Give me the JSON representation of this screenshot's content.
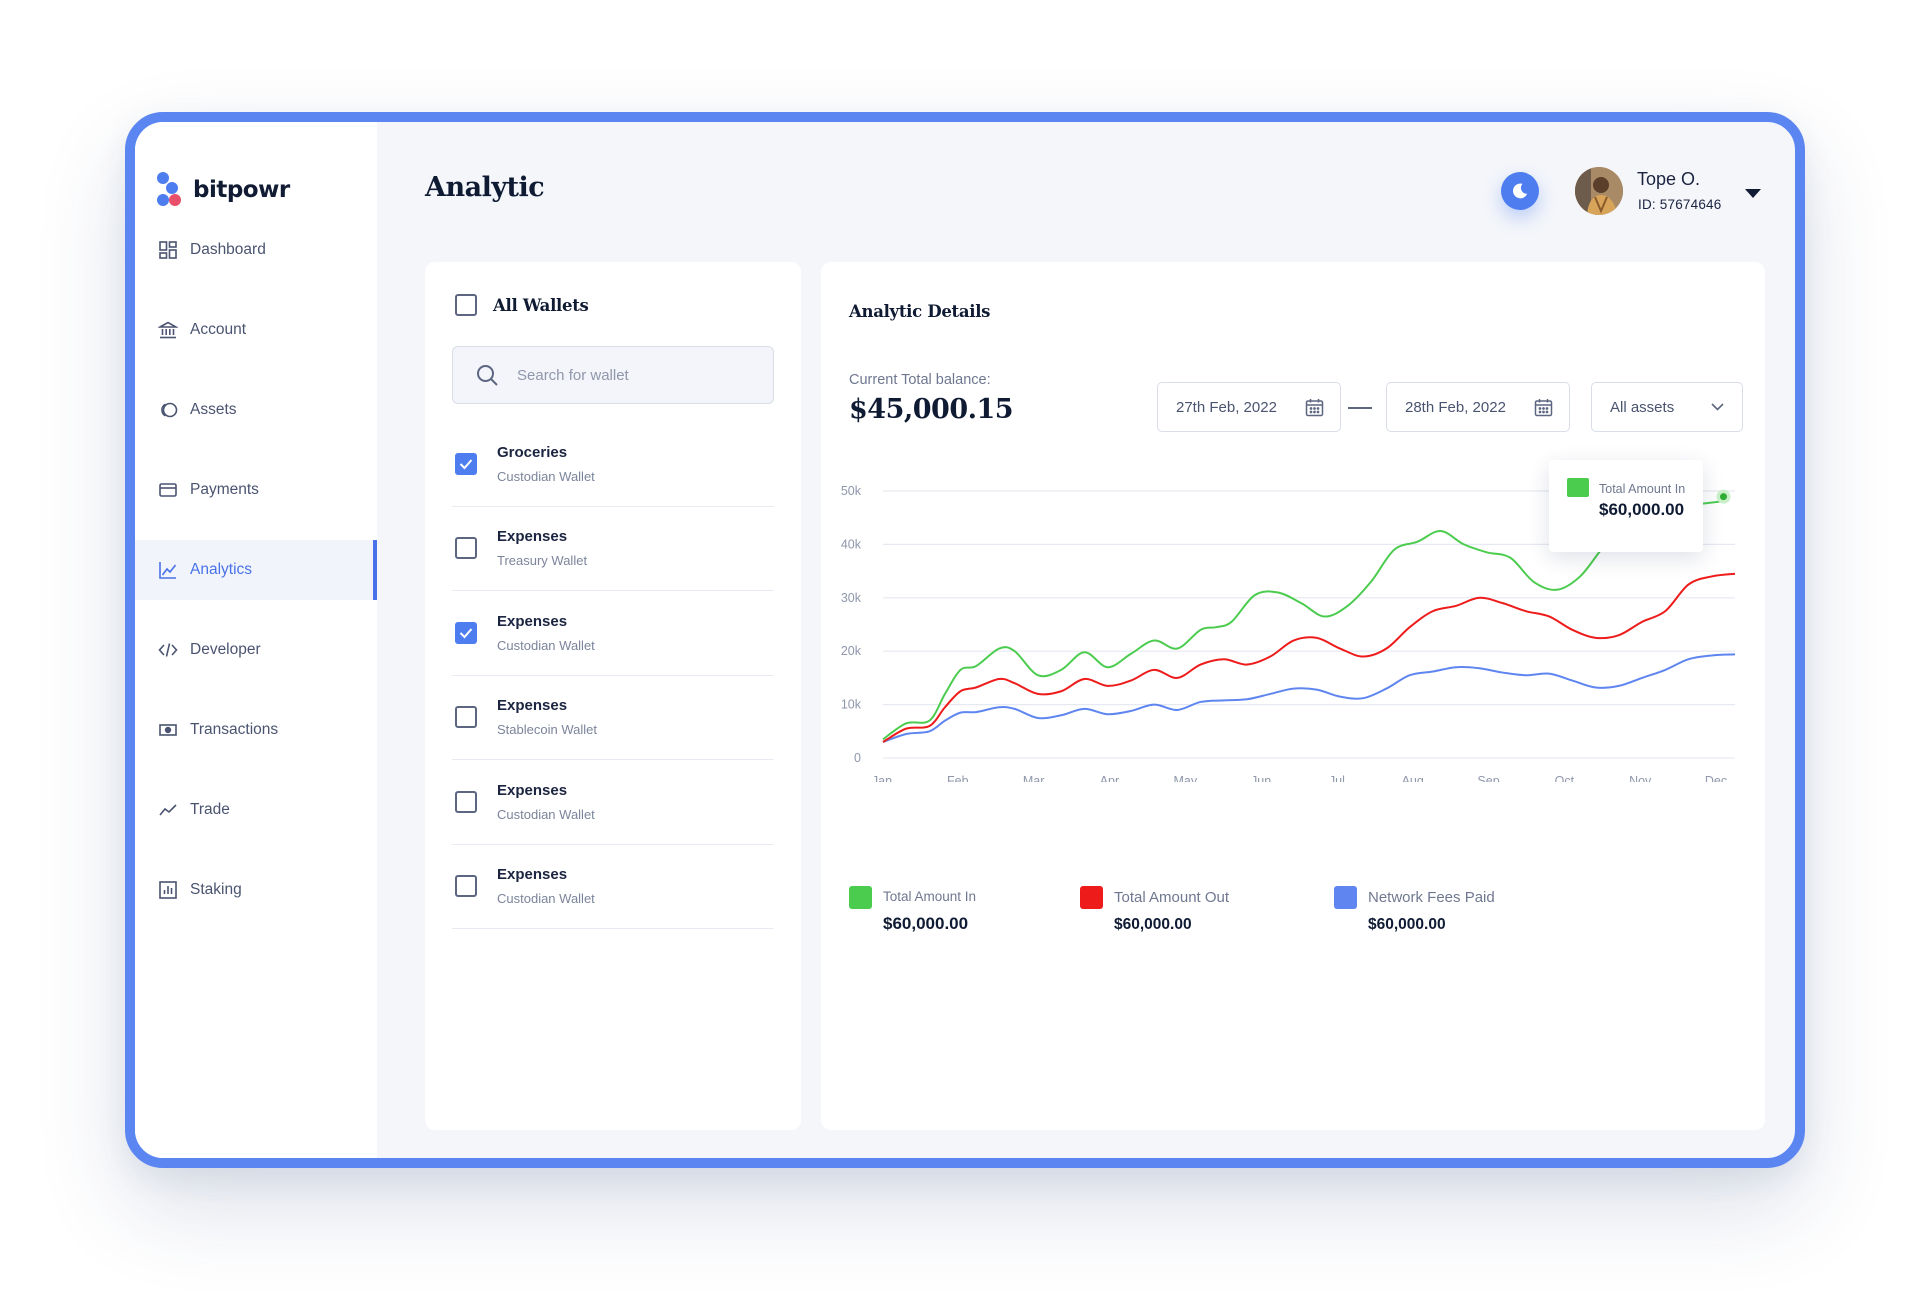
{
  "app": {
    "brand": "bitpowr"
  },
  "header": {
    "title": "Analytic",
    "user_name": "Tope O.",
    "user_id": "ID: 57674646"
  },
  "sidebar": {
    "items": [
      {
        "label": "Dashboard",
        "icon": "dashboard-icon",
        "active": false
      },
      {
        "label": "Account",
        "icon": "bank-icon",
        "active": false
      },
      {
        "label": "Assets",
        "icon": "coins-icon",
        "active": false
      },
      {
        "label": "Payments",
        "icon": "credit-card-icon",
        "active": false
      },
      {
        "label": "Analytics",
        "icon": "analytics-icon",
        "active": true
      },
      {
        "label": "Developer",
        "icon": "code-icon",
        "active": false
      },
      {
        "label": "Transactions",
        "icon": "cash-icon",
        "active": false
      },
      {
        "label": "Trade",
        "icon": "trend-icon",
        "active": false
      },
      {
        "label": "Staking",
        "icon": "bar-chart-icon",
        "active": false
      }
    ]
  },
  "wallets": {
    "all_label": "All Wallets",
    "search_placeholder": "Search for wallet",
    "items": [
      {
        "title": "Groceries",
        "subtitle": "Custodian Wallet",
        "checked": true
      },
      {
        "title": "Expenses",
        "subtitle": "Treasury Wallet",
        "checked": false
      },
      {
        "title": "Expenses",
        "subtitle": "Custodian Wallet",
        "checked": true
      },
      {
        "title": "Expenses",
        "subtitle": "Stablecoin Wallet",
        "checked": false
      },
      {
        "title": "Expenses",
        "subtitle": "Custodian Wallet",
        "checked": false
      },
      {
        "title": "Expenses",
        "subtitle": "Custodian Wallet",
        "checked": false
      }
    ]
  },
  "analytics": {
    "title": "Analytic Details",
    "balance_label": "Current Total balance:",
    "balance_value": "$45,000.15",
    "date_from": "27th Feb, 2022",
    "date_to": "28th Feb, 2022",
    "asset_filter": "All assets",
    "tooltip": {
      "label": "Total Amount In",
      "value": "$60,000.00"
    },
    "legend": [
      {
        "label": "Total Amount In",
        "value": "$60,000.00",
        "color": "#4ccc4f"
      },
      {
        "label": "Total Amount Out",
        "value": "$60,000.00",
        "color": "#ee1b1b"
      },
      {
        "label": "Network Fees Paid",
        "value": "$60,000.00",
        "color": "#5f86f0"
      }
    ]
  },
  "colors": {
    "accent": "#4e7df0",
    "frame": "#5b86f2",
    "in": "#4ccc4f",
    "out": "#ee1b1b",
    "fees": "#5f86f0"
  },
  "chart_data": {
    "type": "line",
    "xlim": [
      0,
      11
    ],
    "ylim": [
      0,
      50000
    ],
    "y_ticks": [
      0,
      10000,
      20000,
      30000,
      40000,
      50000
    ],
    "y_tick_labels": [
      "0",
      "10k",
      "20k",
      "30k",
      "40k",
      "50k"
    ],
    "x_tick_labels": [
      "Jan",
      "Feb",
      "Mar",
      "Apr",
      "May",
      "Jun",
      "Jul",
      "Aug",
      "Sep",
      "Oct",
      "Nov",
      "Dec"
    ],
    "grid": true,
    "series": [
      {
        "name": "Total Amount In",
        "color": "#4ccc4f",
        "x": [
          0,
          0.3,
          0.6,
          0.8,
          1.0,
          1.2,
          1.5,
          1.7,
          2.0,
          2.3,
          2.6,
          2.9,
          3.2,
          3.5,
          3.8,
          4.1,
          4.3,
          4.5,
          4.8,
          5.1,
          5.4,
          5.7,
          6.0,
          6.3,
          6.6,
          6.9,
          7.2,
          7.5,
          7.8,
          8.1,
          8.4,
          8.7,
          9.0,
          9.3,
          9.6,
          9.9,
          10.2,
          10.5,
          10.8
        ],
        "y": [
          3500,
          6500,
          7000,
          12000,
          16500,
          17200,
          20500,
          20000,
          15500,
          16500,
          19800,
          17000,
          19500,
          22000,
          20500,
          24000,
          24500,
          25500,
          30500,
          31000,
          29000,
          26500,
          28500,
          33000,
          39000,
          40500,
          42500,
          40000,
          38500,
          37500,
          33000,
          31500,
          34000,
          39500,
          44000,
          46500,
          47000,
          47500,
          48000
        ]
      },
      {
        "name": "Total Amount Out",
        "color": "#ee1b1b",
        "x": [
          0,
          0.3,
          0.6,
          0.8,
          1.0,
          1.2,
          1.5,
          1.7,
          2.0,
          2.3,
          2.6,
          2.9,
          3.2,
          3.5,
          3.8,
          4.1,
          4.4,
          4.7,
          5.0,
          5.3,
          5.6,
          5.9,
          6.2,
          6.5,
          6.8,
          7.1,
          7.4,
          7.7,
          8.0,
          8.3,
          8.6,
          8.9,
          9.2,
          9.5,
          9.8,
          10.1,
          10.4,
          10.7,
          11.0
        ],
        "y": [
          3000,
          5500,
          6000,
          9500,
          12500,
          13200,
          14800,
          14000,
          12000,
          12500,
          14800,
          13500,
          14500,
          16500,
          15000,
          17500,
          18500,
          17500,
          19000,
          22000,
          22500,
          20500,
          19000,
          20500,
          24500,
          27500,
          28500,
          30000,
          29000,
          27500,
          26500,
          24000,
          22500,
          23000,
          25500,
          27500,
          32500,
          34000,
          34500
        ]
      },
      {
        "name": "Network Fees Paid",
        "color": "#5f86f0",
        "x": [
          0,
          0.3,
          0.6,
          0.8,
          1.0,
          1.2,
          1.5,
          1.7,
          2.0,
          2.3,
          2.6,
          2.9,
          3.2,
          3.5,
          3.8,
          4.1,
          4.4,
          4.7,
          5.0,
          5.3,
          5.6,
          5.9,
          6.2,
          6.5,
          6.8,
          7.1,
          7.4,
          7.7,
          8.0,
          8.3,
          8.6,
          8.9,
          9.2,
          9.5,
          9.8,
          10.1,
          10.4,
          10.7,
          11.0
        ],
        "y": [
          3000,
          4500,
          5000,
          7000,
          8500,
          8600,
          9500,
          9200,
          7500,
          8000,
          9200,
          8200,
          8800,
          10000,
          9000,
          10500,
          10800,
          11000,
          12000,
          13000,
          12800,
          11500,
          11200,
          13000,
          15500,
          16200,
          17000,
          16800,
          16000,
          15500,
          15800,
          14500,
          13200,
          13500,
          15000,
          16500,
          18500,
          19200,
          19400
        ]
      }
    ]
  }
}
